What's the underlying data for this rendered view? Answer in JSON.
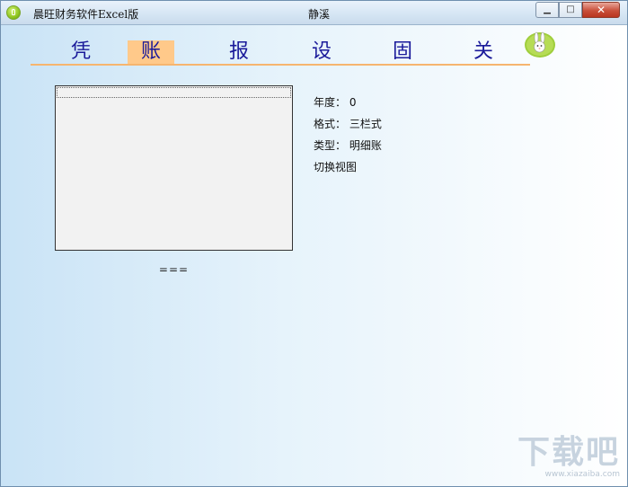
{
  "window": {
    "app_title": "晨旺财务软件Excel版",
    "center_title": "静溪",
    "controls": {
      "minimize": "▁",
      "maximize": "□",
      "close": "✕"
    }
  },
  "nav": {
    "items": [
      {
        "label": "凭",
        "active": false
      },
      {
        "label": "账",
        "active": true
      },
      {
        "label": "报",
        "active": false
      },
      {
        "label": "设",
        "active": false
      },
      {
        "label": "固",
        "active": false
      },
      {
        "label": "关",
        "active": false
      }
    ],
    "accent_color": "#ffc98a",
    "line_color": "#f6b56f"
  },
  "preview": {
    "caption": "==="
  },
  "info": {
    "year": "年度：  0",
    "format": "格式：  三栏式",
    "type": "类型：  明细账",
    "switch_view": "切换视图"
  },
  "watermark": {
    "text": "下载吧",
    "url": "www.xiazaiba.com"
  }
}
